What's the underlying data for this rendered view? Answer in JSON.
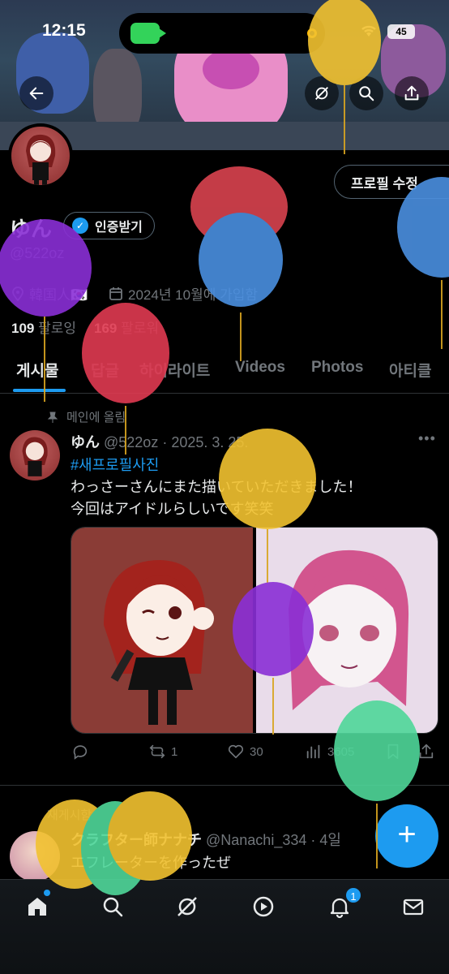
{
  "status_bar": {
    "time": "12:15",
    "battery": "45"
  },
  "colors": {
    "accent": "#1d9bf0",
    "muted": "#71767b",
    "text": "#e7e9ea",
    "border": "#2f3336"
  },
  "profile": {
    "edit_label": "프로필 수정",
    "name": "ゆん",
    "verify_label": "인증받기",
    "handle": "@522oz",
    "location": "韓国人🇰🇷",
    "joined": "2024년 10월에 가입함",
    "following_count": "109",
    "following_label": "팔로잉",
    "followers_count": "169",
    "followers_label": "팔로워"
  },
  "tabs": [
    {
      "label": "게시물"
    },
    {
      "label": "답글"
    },
    {
      "label": "하이라이트"
    },
    {
      "label": "Videos"
    },
    {
      "label": "Photos"
    },
    {
      "label": "아티클"
    }
  ],
  "post": {
    "pinned_label": "메인에 올림",
    "name": "ゆん",
    "meta": " @522oz · 2025. 3. 25.",
    "hashtag": "#새프로필사진",
    "line1": "わっさーさんにまた描いていただきました！",
    "line2": "今回はアイドルらしいです笑笑",
    "replies": "",
    "reposts": "1",
    "likes": "30",
    "views": "3605"
  },
  "post2": {
    "repost_label": "재게시함",
    "name": "クラフター師ナナチ",
    "meta": " @Nanachi_334 · 4일",
    "text": "エフレーターを作ったぜ"
  },
  "fab_label": "+",
  "nav": {
    "notification_badge": "1"
  },
  "icons": [
    "back-icon",
    "search-icon",
    "share-icon",
    "verified-icon",
    "location-icon",
    "calendar-icon",
    "pin-icon",
    "reply-icon",
    "repost-icon",
    "like-icon",
    "views-icon",
    "bookmark-icon",
    "home-icon",
    "grok-icon",
    "video-icon",
    "bell-icon",
    "mail-icon"
  ]
}
